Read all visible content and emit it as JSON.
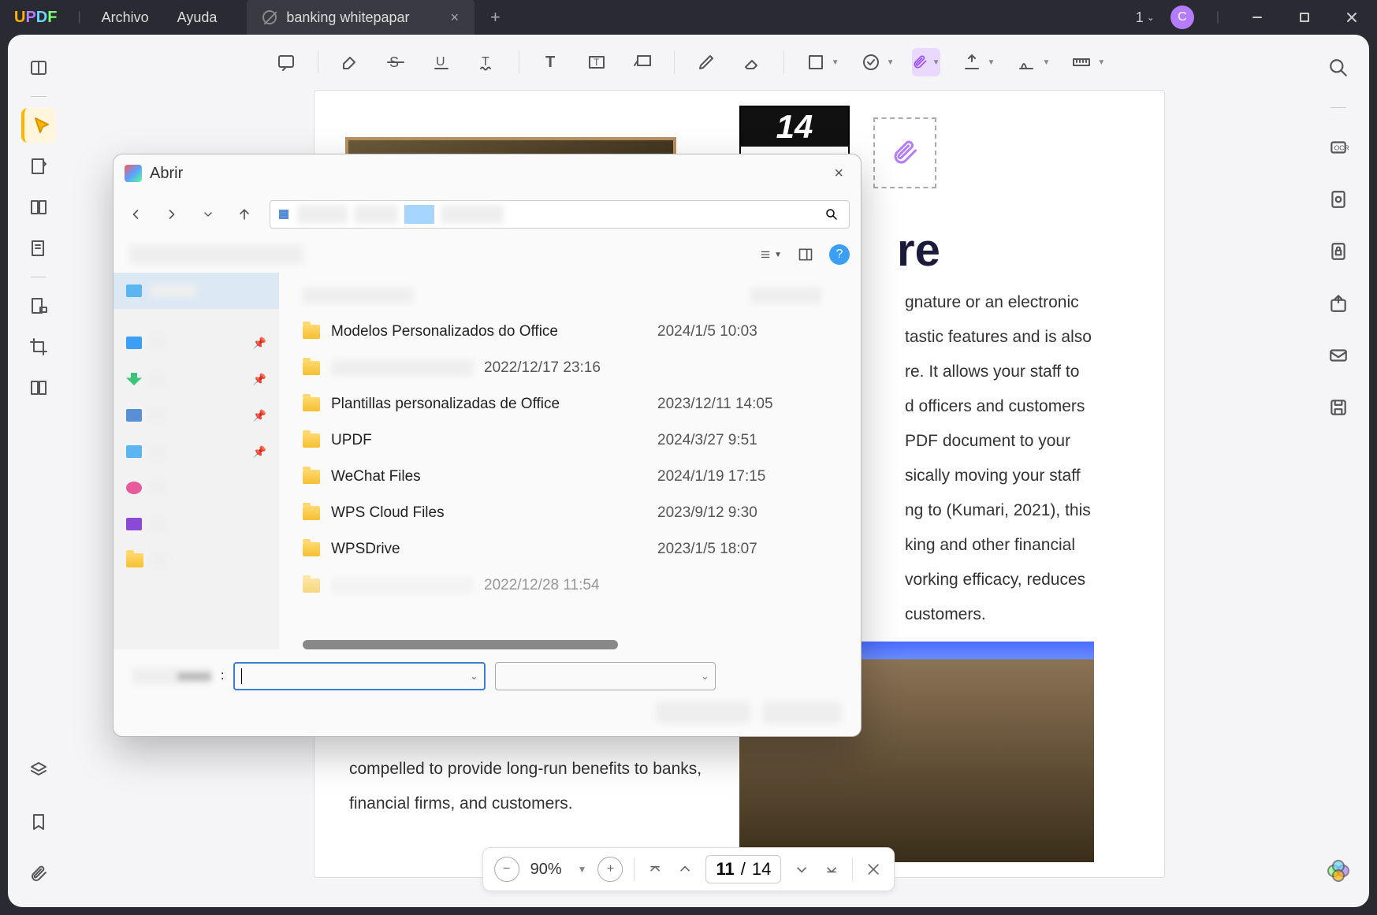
{
  "titlebar": {
    "menu_file": "Archivo",
    "menu_help": "Ayuda",
    "tab_title": "banking whitepapar",
    "count": "1",
    "avatar_letter": "C"
  },
  "dialog": {
    "title": "Abrir",
    "files": [
      {
        "name": "Modelos Personalizados do Office",
        "date": "2024/1/5 10:03"
      },
      {
        "name": "",
        "date": "2022/12/17 23:16"
      },
      {
        "name": "Plantillas personalizadas de Office",
        "date": "2023/12/11 14:05"
      },
      {
        "name": "UPDF",
        "date": "2024/3/27 9:51"
      },
      {
        "name": "WeChat Files",
        "date": "2024/1/19 17:15"
      },
      {
        "name": "WPS Cloud Files",
        "date": "2023/9/12 9:30"
      },
      {
        "name": "WPSDrive",
        "date": "2023/1/5 18:07"
      },
      {
        "name": "",
        "date": "2022/12/28 11:54"
      }
    ],
    "footer_label": ":"
  },
  "page": {
    "calendar_day": "14",
    "heading_fragment": "re",
    "body_fragment": "gnature or an electronic\ntastic features and is also\nre. It allows your staff to\nd officers and customers\n PDF document to your\nsically moving your staff\nng to (Kumari, 2021), this\nking and other financial\nvorking efficacy, reduces\ncustomers.",
    "body2_l1": "compelled to provide long-run benefits to banks,",
    "body2_l2": "financial firms, and customers."
  },
  "bottombar": {
    "zoom": "90%",
    "page_current": "11",
    "page_sep": "/",
    "page_total": "14"
  }
}
